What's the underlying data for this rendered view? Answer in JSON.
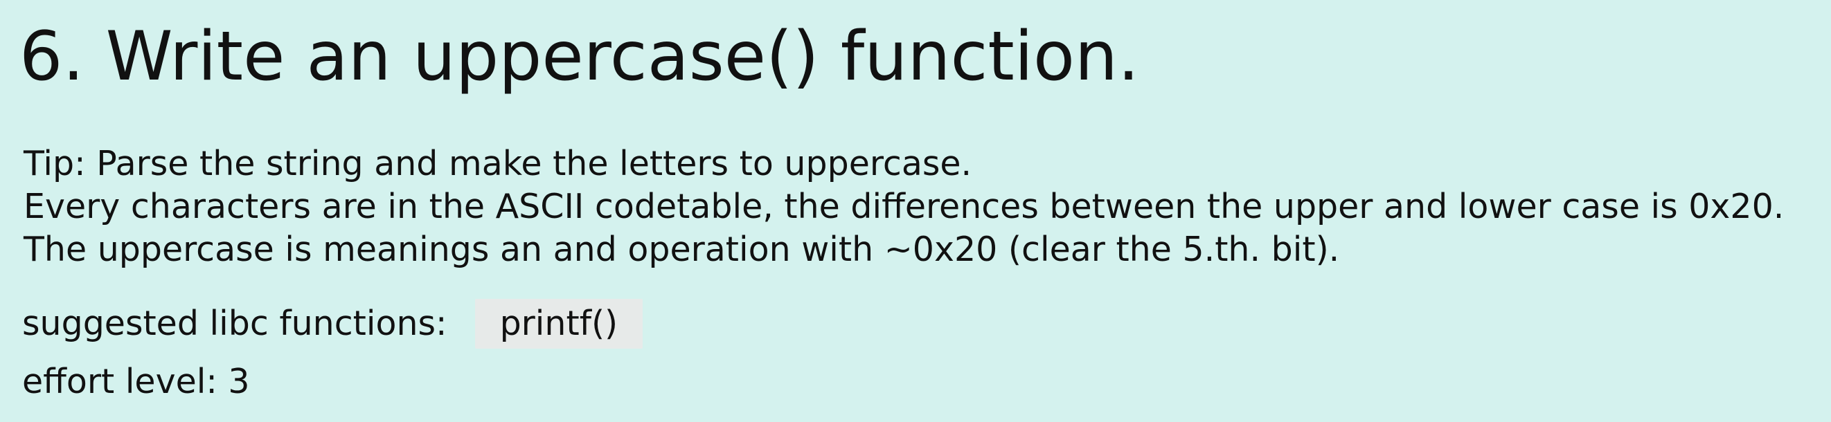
{
  "heading": "6. Write an uppercase() function.",
  "tip": {
    "line1": "Tip: Parse the string and make the letters to uppercase.",
    "line2": "Every characters are in the ASCII codetable, the differences between the upper and lower case is 0x20.",
    "line3": "The uppercase is meanings an and operation with ~0x20 (clear the 5.th. bit)."
  },
  "libc": {
    "label": "suggested libc functions:",
    "function": "printf()"
  },
  "effort": {
    "text": "effort level: 3"
  },
  "colors": {
    "background": "#d4f2ee",
    "code_chip": "#e7eae9",
    "text": "#111111"
  }
}
